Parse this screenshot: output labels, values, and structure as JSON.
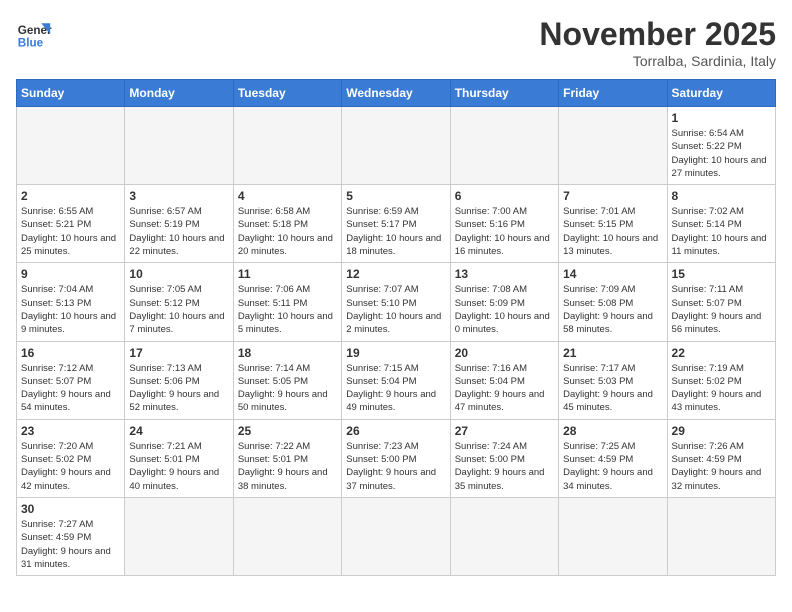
{
  "logo": {
    "text_general": "General",
    "text_blue": "Blue"
  },
  "header": {
    "month_year": "November 2025",
    "location": "Torralba, Sardinia, Italy"
  },
  "weekdays": [
    "Sunday",
    "Monday",
    "Tuesday",
    "Wednesday",
    "Thursday",
    "Friday",
    "Saturday"
  ],
  "weeks": [
    [
      {
        "day": "",
        "info": ""
      },
      {
        "day": "",
        "info": ""
      },
      {
        "day": "",
        "info": ""
      },
      {
        "day": "",
        "info": ""
      },
      {
        "day": "",
        "info": ""
      },
      {
        "day": "",
        "info": ""
      },
      {
        "day": "1",
        "info": "Sunrise: 6:54 AM\nSunset: 5:22 PM\nDaylight: 10 hours and 27 minutes."
      }
    ],
    [
      {
        "day": "2",
        "info": "Sunrise: 6:55 AM\nSunset: 5:21 PM\nDaylight: 10 hours and 25 minutes."
      },
      {
        "day": "3",
        "info": "Sunrise: 6:57 AM\nSunset: 5:19 PM\nDaylight: 10 hours and 22 minutes."
      },
      {
        "day": "4",
        "info": "Sunrise: 6:58 AM\nSunset: 5:18 PM\nDaylight: 10 hours and 20 minutes."
      },
      {
        "day": "5",
        "info": "Sunrise: 6:59 AM\nSunset: 5:17 PM\nDaylight: 10 hours and 18 minutes."
      },
      {
        "day": "6",
        "info": "Sunrise: 7:00 AM\nSunset: 5:16 PM\nDaylight: 10 hours and 16 minutes."
      },
      {
        "day": "7",
        "info": "Sunrise: 7:01 AM\nSunset: 5:15 PM\nDaylight: 10 hours and 13 minutes."
      },
      {
        "day": "8",
        "info": "Sunrise: 7:02 AM\nSunset: 5:14 PM\nDaylight: 10 hours and 11 minutes."
      }
    ],
    [
      {
        "day": "9",
        "info": "Sunrise: 7:04 AM\nSunset: 5:13 PM\nDaylight: 10 hours and 9 minutes."
      },
      {
        "day": "10",
        "info": "Sunrise: 7:05 AM\nSunset: 5:12 PM\nDaylight: 10 hours and 7 minutes."
      },
      {
        "day": "11",
        "info": "Sunrise: 7:06 AM\nSunset: 5:11 PM\nDaylight: 10 hours and 5 minutes."
      },
      {
        "day": "12",
        "info": "Sunrise: 7:07 AM\nSunset: 5:10 PM\nDaylight: 10 hours and 2 minutes."
      },
      {
        "day": "13",
        "info": "Sunrise: 7:08 AM\nSunset: 5:09 PM\nDaylight: 10 hours and 0 minutes."
      },
      {
        "day": "14",
        "info": "Sunrise: 7:09 AM\nSunset: 5:08 PM\nDaylight: 9 hours and 58 minutes."
      },
      {
        "day": "15",
        "info": "Sunrise: 7:11 AM\nSunset: 5:07 PM\nDaylight: 9 hours and 56 minutes."
      }
    ],
    [
      {
        "day": "16",
        "info": "Sunrise: 7:12 AM\nSunset: 5:07 PM\nDaylight: 9 hours and 54 minutes."
      },
      {
        "day": "17",
        "info": "Sunrise: 7:13 AM\nSunset: 5:06 PM\nDaylight: 9 hours and 52 minutes."
      },
      {
        "day": "18",
        "info": "Sunrise: 7:14 AM\nSunset: 5:05 PM\nDaylight: 9 hours and 50 minutes."
      },
      {
        "day": "19",
        "info": "Sunrise: 7:15 AM\nSunset: 5:04 PM\nDaylight: 9 hours and 49 minutes."
      },
      {
        "day": "20",
        "info": "Sunrise: 7:16 AM\nSunset: 5:04 PM\nDaylight: 9 hours and 47 minutes."
      },
      {
        "day": "21",
        "info": "Sunrise: 7:17 AM\nSunset: 5:03 PM\nDaylight: 9 hours and 45 minutes."
      },
      {
        "day": "22",
        "info": "Sunrise: 7:19 AM\nSunset: 5:02 PM\nDaylight: 9 hours and 43 minutes."
      }
    ],
    [
      {
        "day": "23",
        "info": "Sunrise: 7:20 AM\nSunset: 5:02 PM\nDaylight: 9 hours and 42 minutes."
      },
      {
        "day": "24",
        "info": "Sunrise: 7:21 AM\nSunset: 5:01 PM\nDaylight: 9 hours and 40 minutes."
      },
      {
        "day": "25",
        "info": "Sunrise: 7:22 AM\nSunset: 5:01 PM\nDaylight: 9 hours and 38 minutes."
      },
      {
        "day": "26",
        "info": "Sunrise: 7:23 AM\nSunset: 5:00 PM\nDaylight: 9 hours and 37 minutes."
      },
      {
        "day": "27",
        "info": "Sunrise: 7:24 AM\nSunset: 5:00 PM\nDaylight: 9 hours and 35 minutes."
      },
      {
        "day": "28",
        "info": "Sunrise: 7:25 AM\nSunset: 4:59 PM\nDaylight: 9 hours and 34 minutes."
      },
      {
        "day": "29",
        "info": "Sunrise: 7:26 AM\nSunset: 4:59 PM\nDaylight: 9 hours and 32 minutes."
      }
    ],
    [
      {
        "day": "30",
        "info": "Sunrise: 7:27 AM\nSunset: 4:59 PM\nDaylight: 9 hours and 31 minutes."
      },
      {
        "day": "",
        "info": ""
      },
      {
        "day": "",
        "info": ""
      },
      {
        "day": "",
        "info": ""
      },
      {
        "day": "",
        "info": ""
      },
      {
        "day": "",
        "info": ""
      },
      {
        "day": "",
        "info": ""
      }
    ]
  ]
}
